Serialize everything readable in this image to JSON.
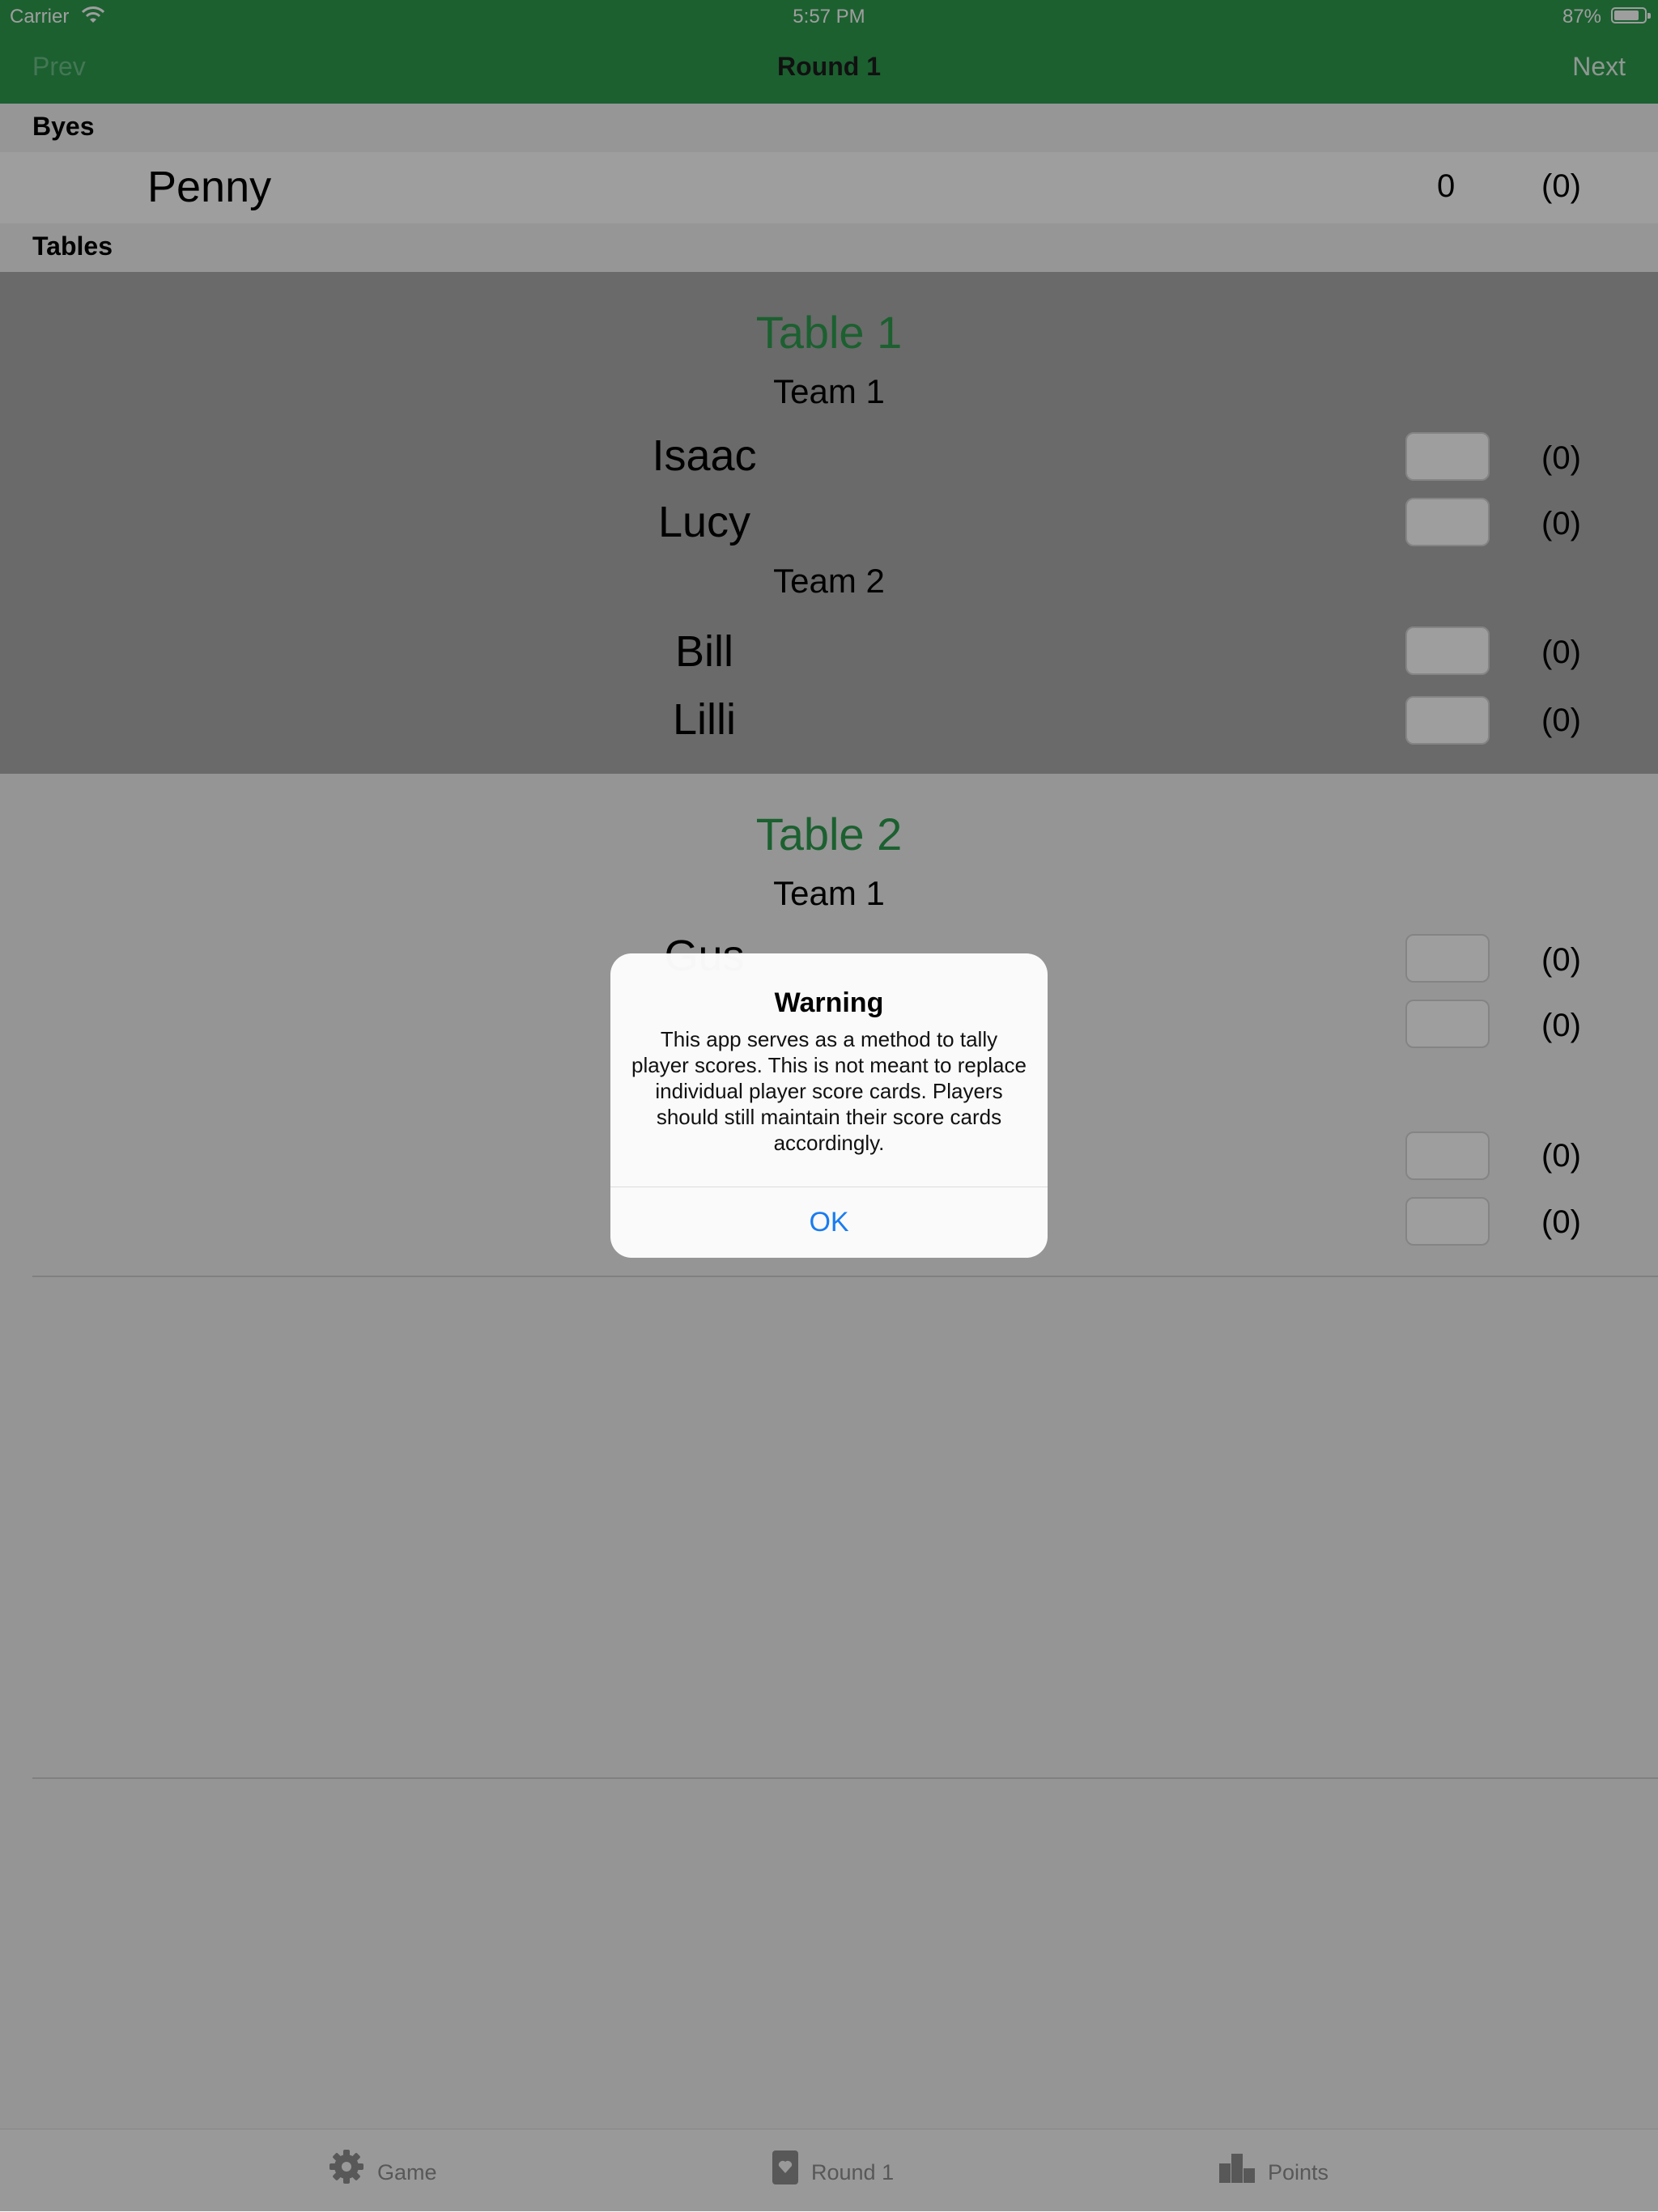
{
  "status_bar": {
    "carrier": "Carrier",
    "time": "5:57 PM",
    "battery": "87%",
    "battery_level": 0.87
  },
  "nav": {
    "prev": "Prev",
    "title": "Round 1",
    "next": "Next"
  },
  "byes": {
    "header": "Byes",
    "players": [
      {
        "name": "Penny",
        "score": "0",
        "total": "(0)"
      }
    ]
  },
  "tables_header": "Tables",
  "tables": [
    {
      "title": "Table 1",
      "teams": [
        {
          "label": "Team 1",
          "players": [
            {
              "name": "Isaac",
              "total": "(0)"
            },
            {
              "name": "Lucy",
              "total": "(0)"
            }
          ]
        },
        {
          "label": "Team 2",
          "players": [
            {
              "name": "Bill",
              "total": "(0)"
            },
            {
              "name": "Lilli",
              "total": "(0)"
            }
          ]
        }
      ]
    },
    {
      "title": "Table 2",
      "teams": [
        {
          "label": "Team 1",
          "players": [
            {
              "name": "Gus",
              "total": "(0)"
            },
            {
              "name": "",
              "total": "(0)"
            }
          ]
        },
        {
          "label": "",
          "players": [
            {
              "name": "",
              "total": "(0)"
            },
            {
              "name": "",
              "total": "(0)"
            }
          ]
        }
      ]
    }
  ],
  "tab_bar": {
    "game": "Game",
    "round": "Round 1",
    "points": "Points"
  },
  "alert": {
    "title": "Warning",
    "message": "This app serves as a method to tally player scores. This is not meant to replace individual player score cards. Players should still maintain their score cards accordingly.",
    "ok": "OK"
  }
}
